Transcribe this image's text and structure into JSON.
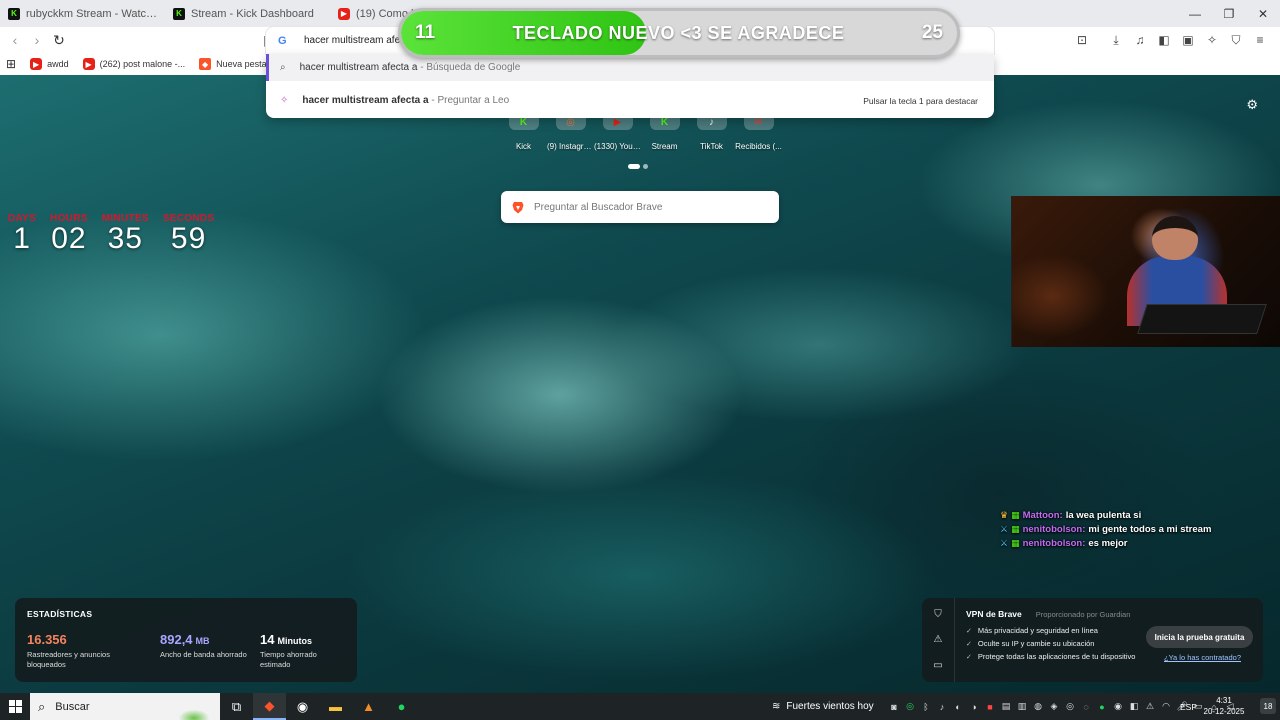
{
  "tabs": [
    {
      "title": "rubyckkm Stream - Watch Live on Ki",
      "icon": "kick-icon"
    },
    {
      "title": "Stream - Kick Dashboard",
      "icon": "kick-icon"
    },
    {
      "title": "(19) Como hac",
      "icon": "youtube-icon"
    }
  ],
  "window": {
    "minimize": "—",
    "maximize": "❐",
    "close": "✕"
  },
  "omnibox": {
    "value": "hacer multistream afec"
  },
  "suggestions": [
    {
      "query": "hacer multistream afecta a",
      "suffix": " - Búsqueda de Google"
    },
    {
      "query": "hacer multistream afecta a",
      "suffix": " - Preguntar a Leo",
      "hint": "Pulsar la tecla 1 para destacar"
    }
  ],
  "banner": {
    "left": "11",
    "text": "TECLADO NUEVO <3 SE AGRADECE",
    "right": "25",
    "progress": 0.44
  },
  "bookmarks": [
    {
      "label": "awdd"
    },
    {
      "label": "(262) post malone -..."
    },
    {
      "label": "Nueva pestaña"
    }
  ],
  "shortcuts": [
    {
      "label": "Kick"
    },
    {
      "label": "(9) Instagra..."
    },
    {
      "label": "(1330) YouT..."
    },
    {
      "label": "Stream"
    },
    {
      "label": "TikTok"
    },
    {
      "label": "Recibidos (..."
    }
  ],
  "search": {
    "placeholder": "Preguntar al Buscador Brave"
  },
  "countdown": [
    {
      "label": "DAYS",
      "value": "1"
    },
    {
      "label": "HOURS",
      "value": "02"
    },
    {
      "label": "MINUTES",
      "value": "35"
    },
    {
      "label": "SECONDS",
      "value": "59"
    }
  ],
  "chat": [
    {
      "user": "Mattoon:",
      "message": "la wea pulenta si"
    },
    {
      "user": "nenitobolson:",
      "message": "mi gente todos a mi stream"
    },
    {
      "user": "nenitobolson:",
      "message": "es mejor"
    }
  ],
  "stats": {
    "title": "ESTADÍSTICAS",
    "items": [
      {
        "value": "16.356",
        "unit": "",
        "desc": "Rastreadores y anuncios bloqueados",
        "color": "#f4845f"
      },
      {
        "value": "892,4",
        "unit": "MB",
        "desc": "Ancho de banda ahorrado",
        "color": "#a9a6ff"
      },
      {
        "value": "14",
        "unit": "Minutos",
        "desc": "Tiempo ahorrado estimado",
        "color": "#ffffff"
      }
    ]
  },
  "vpn": {
    "title": "VPN de Brave",
    "provider": "Proporcionado por Guardian",
    "features": [
      "Más privacidad y seguridad en línea",
      "Oculte su IP y cambie su ubicación",
      "Protege todas las aplicaciones de tu dispositivo"
    ],
    "cta": "Inicia la prueba gratuita",
    "link": "¿Ya lo has contratado?"
  },
  "taskbar": {
    "search": "Buscar",
    "weather": "Fuertes vientos hoy",
    "lang": "ESP",
    "time": "4:31",
    "date": "20-12-2025",
    "notifications": "18"
  },
  "colors": {
    "accent": "#6b4fd8",
    "banner_fill": "#2fc413",
    "countdown_label": "#d3182e",
    "chat_user": "#c26cf0"
  }
}
